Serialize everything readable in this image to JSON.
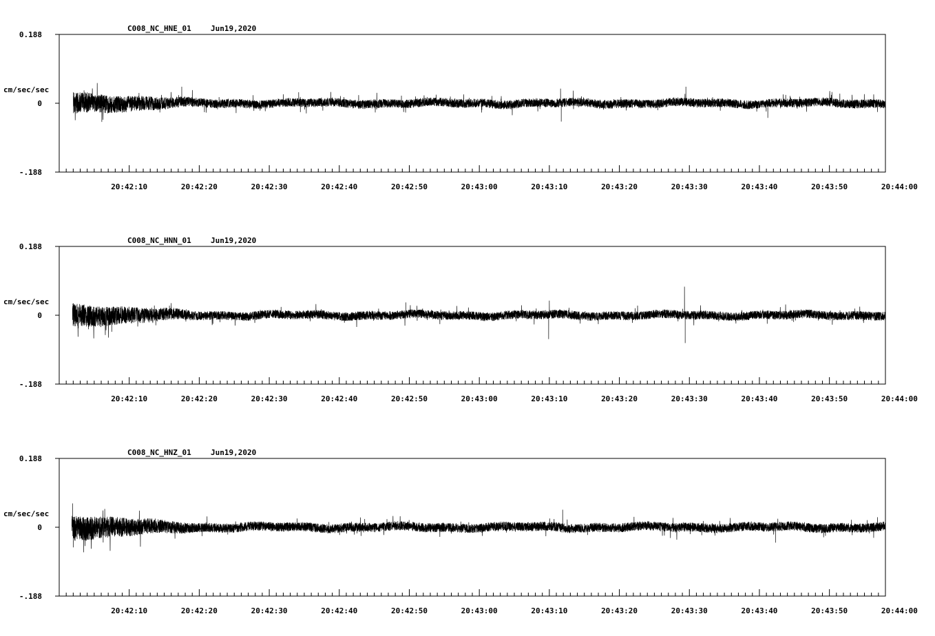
{
  "chart_data": [
    {
      "type": "line",
      "title": "C008_NC_HNE_01",
      "date": "Jun19,2020",
      "ylabel": "cm/sec/sec",
      "ylim": [
        -0.188,
        0.188
      ],
      "y_tick_labels": [
        "0.188",
        "0",
        "-.188"
      ],
      "x_tick_labels": [
        "20:42:10",
        "20:42:20",
        "20:42:30",
        "20:42:40",
        "20:42:50",
        "20:43:00",
        "20:43:10",
        "20:43:20",
        "20:43:30",
        "20:43:40",
        "20:43:50",
        "20:44:00"
      ],
      "x_range_seconds": [
        130,
        248
      ],
      "trace": {
        "start_seconds": 132,
        "end_seconds": 248,
        "base_amplitude": 0.024,
        "onset_amplitude": 0.036,
        "spikes": [
          {
            "t": 147.5,
            "value": 0.045
          },
          {
            "t": 164.2,
            "value": 0.03
          },
          {
            "t": 191.8,
            "value": 0.02
          },
          {
            "t": 201.6,
            "value": 0.04
          },
          {
            "t": 201.7,
            "value": -0.05
          },
          {
            "t": 219.5,
            "value": 0.045
          },
          {
            "t": 231.2,
            "value": -0.04
          }
        ]
      }
    },
    {
      "type": "line",
      "title": "C008_NC_HNN_01",
      "date": "Jun19,2020",
      "ylabel": "cm/sec/sec",
      "ylim": [
        -0.188,
        0.188
      ],
      "y_tick_labels": [
        "0.188",
        "0",
        "-.188"
      ],
      "x_tick_labels": [
        "20:42:10",
        "20:42:20",
        "20:42:30",
        "20:42:40",
        "20:42:50",
        "20:43:00",
        "20:43:10",
        "20:43:20",
        "20:43:30",
        "20:43:40",
        "20:43:50",
        "20:44:00"
      ],
      "x_range_seconds": [
        130,
        248
      ],
      "trace": {
        "start_seconds": 131.9,
        "end_seconds": 248,
        "base_amplitude": 0.024,
        "onset_amplitude": 0.04,
        "spikes": [
          {
            "t": 137.5,
            "value": -0.045
          },
          {
            "t": 179.5,
            "value": 0.035
          },
          {
            "t": 199.9,
            "value": -0.065
          },
          {
            "t": 200.0,
            "value": 0.04
          },
          {
            "t": 219.3,
            "value": 0.078
          },
          {
            "t": 219.4,
            "value": -0.076
          }
        ]
      }
    },
    {
      "type": "line",
      "title": "C008_NC_HNZ_01",
      "date": "Jun19,2020",
      "ylabel": "cm/sec/sec",
      "ylim": [
        -0.188,
        0.188
      ],
      "y_tick_labels": [
        "0.188",
        "0",
        "-.188"
      ],
      "x_tick_labels": [
        "20:42:10",
        "20:42:20",
        "20:42:30",
        "20:42:40",
        "20:42:50",
        "20:43:00",
        "20:43:10",
        "20:43:20",
        "20:43:30",
        "20:43:40",
        "20:43:50",
        "20:44:00"
      ],
      "x_range_seconds": [
        130,
        248
      ],
      "trace": {
        "start_seconds": 131.8,
        "end_seconds": 248,
        "base_amplitude": 0.025,
        "onset_amplitude": 0.045,
        "spikes": [
          {
            "t": 131.9,
            "value": 0.065
          },
          {
            "t": 132.0,
            "value": -0.055
          },
          {
            "t": 136.5,
            "value": 0.05
          },
          {
            "t": 201.9,
            "value": 0.048
          },
          {
            "t": 232.3,
            "value": -0.042
          }
        ]
      }
    }
  ]
}
